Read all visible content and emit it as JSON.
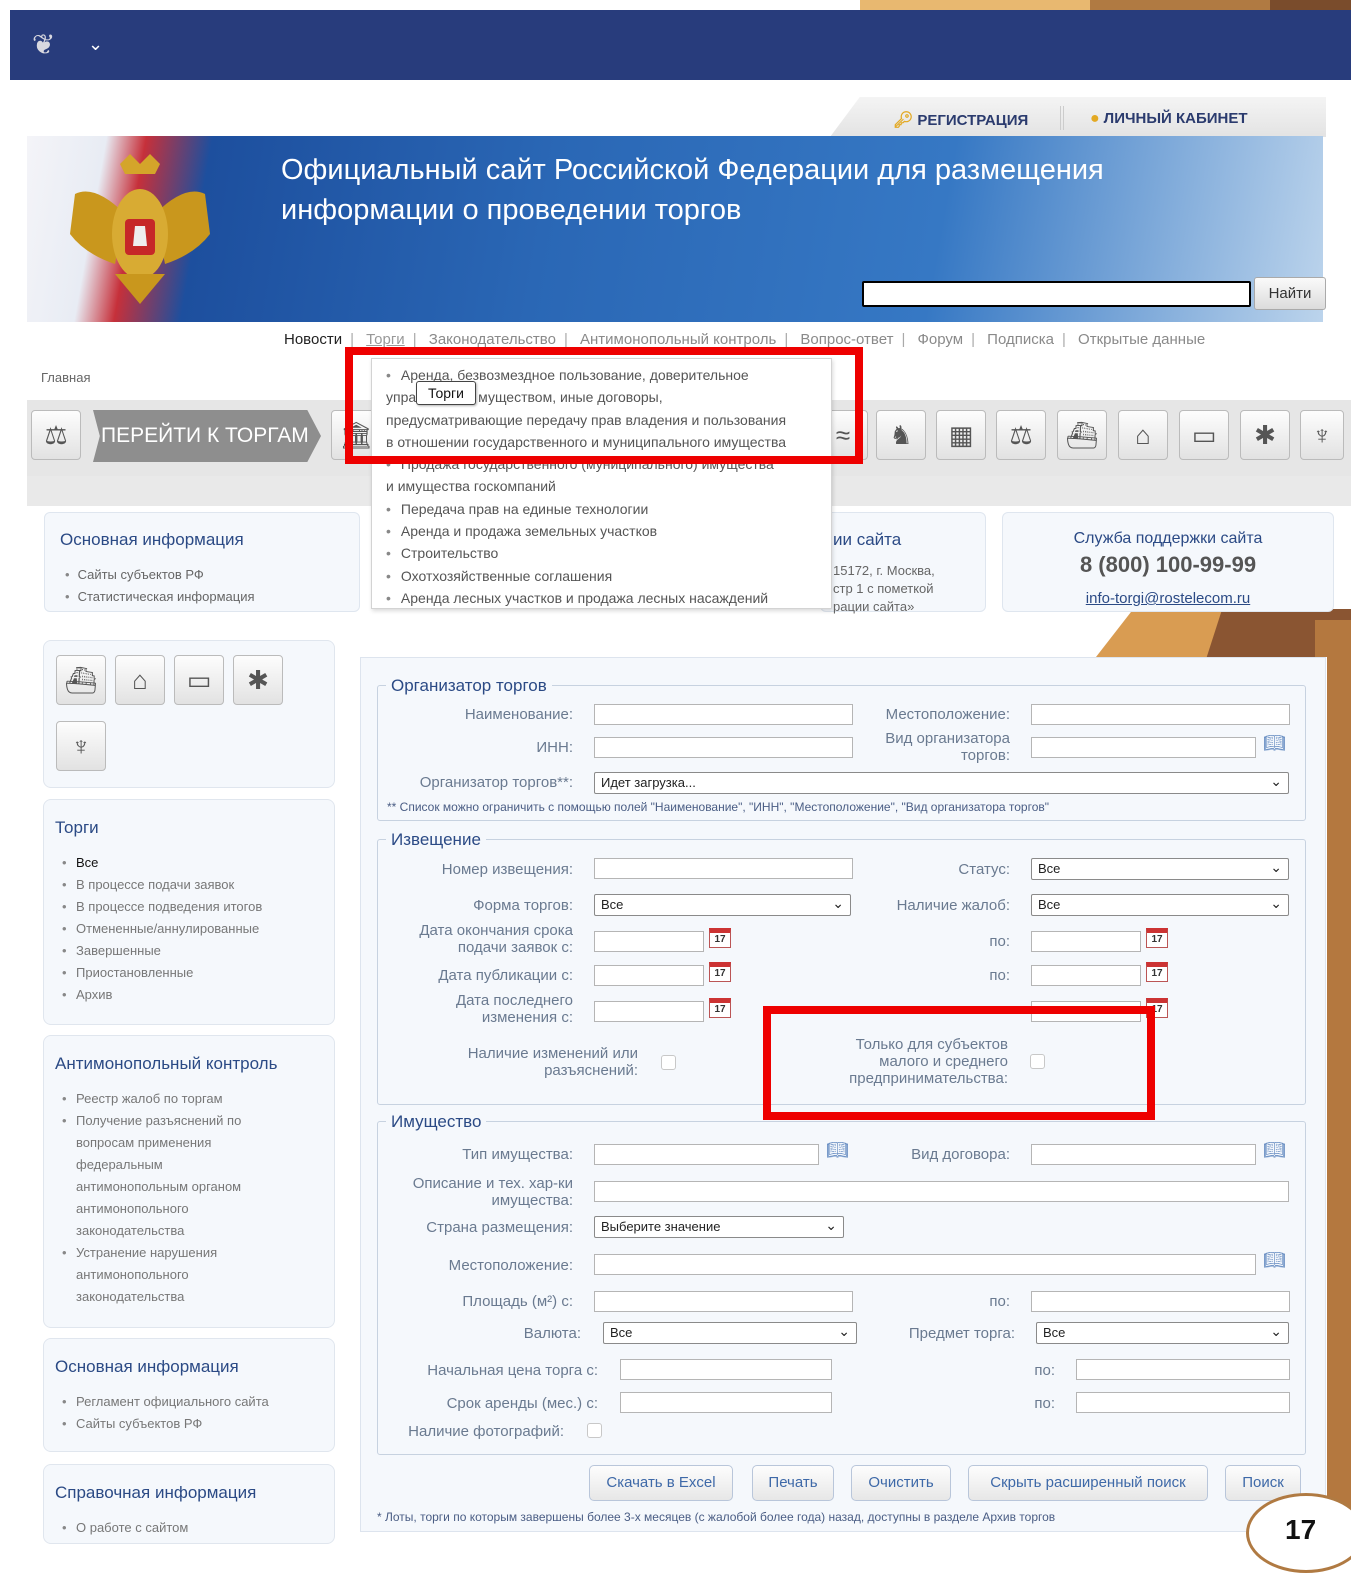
{
  "header": {
    "register": "РЕГИСТРАЦИЯ",
    "cabinet": "ЛИЧНЫЙ КАБИНЕТ",
    "title_line1": "Официальный сайт Российской Федерации для размещения",
    "title_line2": "информации о проведении торгов",
    "search_button": "Найти"
  },
  "nav": [
    "Новости",
    "Торги",
    "Законодательство",
    "Антимонопольный контроль",
    "Вопрос-ответ",
    "Форум",
    "Подписка",
    "Открытые данные"
  ],
  "breadcrumb": "Главная",
  "goto_torgi": "ПЕРЕЙТИ К ТОРГАМ",
  "tooltip": "Торги",
  "dropdown": {
    "line1": "Аренда, безвозмездное пользование, доверительное",
    "line2_a": "упра",
    "line2_b": "муществом, иные договоры,",
    "line3": "предусматривающие передачу прав владения и пользования",
    "line4": "в отношении государственного и муниципального имущества",
    "line5": "Продажа государственного (муниципального) имущества",
    "line6": "и имущества госкомпаний",
    "line7": "Передача прав на единые технологии",
    "line8": "Аренда и продажа земельных участков",
    "line9": "Строительство",
    "line10": "Охотхозяйственные соглашения",
    "line11": "Аренда лесных участков и продажа лесных насаждений"
  },
  "info_top": {
    "main_title": "Основная информация",
    "main_items": [
      "Сайты субъектов РФ",
      "Статистическая информация"
    ],
    "middle_title": "ии сайта",
    "middle_l1": "15172, г. Москва,",
    "middle_l2": "стр 1 с пометкой",
    "middle_l3": "рации сайта»",
    "support_title": "Служба поддержки сайта",
    "support_phone": "8 (800) 100-99-99",
    "support_email": "info-torgi@rostelecom.ru"
  },
  "sidebar": {
    "torgi_title": "Торги",
    "torgi_items": [
      "Все",
      "В процессе подачи заявок",
      "В процессе подведения итогов",
      "Отмененные/аннулированные",
      "Завершенные",
      "Приостановленные",
      "Архив"
    ],
    "anti_title": "Антимонопольный контроль",
    "anti_items": [
      "Реестр жалоб по торгам",
      "Получение разъяснений по вопросам применения федеральным антимонопольным органом антимонопольного законодательства",
      "Устранение нарушения антимонопольного законодательства"
    ],
    "main_title": "Основная информация",
    "main_items": [
      "Регламент официального сайта",
      "Сайты субъектов РФ"
    ],
    "ref_title": "Справочная информация",
    "ref_items": [
      "О работе с сайтом"
    ]
  },
  "form": {
    "org_legend": "Организатор торгов",
    "org_name": "Наименование:",
    "org_location": "Местоположение:",
    "org_inn": "ИНН:",
    "org_type_l1": "Вид организатора",
    "org_type_l2": "торгов:",
    "org_select_label": "Организатор торгов**:",
    "org_select_value": "Идет загрузка...",
    "org_note": "** Список можно ограничить с помощью полей \"Наименование\", \"ИНН\", \"Местоположение\", \"Вид организатора торгов\"",
    "notice_legend": "Извещение",
    "notice_number": "Номер извещения:",
    "status": "Статус:",
    "status_value": "Все",
    "form_torgi": "Форма торгов:",
    "form_torgi_value": "Все",
    "complaints": "Наличие жалоб:",
    "complaints_value": "Все",
    "deadline_l1": "Дата окончания срока",
    "deadline_l2": "подачи заявок с:",
    "pub_date": "Дата публикации с:",
    "last_change_l1": "Дата последнего",
    "last_change_l2": "изменения с:",
    "to": "по:",
    "cal_day": "17",
    "changes_l1": "Наличие изменений или",
    "changes_l2": "разъяснений:",
    "sme_l1": "Только для субъектов",
    "sme_l2": "малого и среднего",
    "sme_l3": "предпринимательства:",
    "property_legend": "Имущество",
    "prop_type": "Тип имущества:",
    "contract_type": "Вид договора:",
    "desc_l1": "Описание и тех. хар-ки",
    "desc_l2": "имущества:",
    "country": "Страна размещения:",
    "country_value": "Выберите значение",
    "location": "Местоположение:",
    "area": "Площадь (м²) с:",
    "currency": "Валюта:",
    "currency_value": "Все",
    "subject": "Предмет торга:",
    "subject_value": "Все",
    "start_price": "Начальная цена торга с:",
    "lease_term": "Срок аренды (мес.) с:",
    "photos": "Наличие фотографий:",
    "footnote": "* Лоты, торги по которым завершены более 3-х месяцев (с жалобой более года) назад, доступны в разделе Архив торгов"
  },
  "buttons": {
    "excel": "Скачать в Excel",
    "print": "Печать",
    "clear": "Очистить",
    "hide": "Скрыть расширенный поиск",
    "search": "Поиск"
  },
  "slide_number": "17",
  "icons": [
    "emblem-icon",
    "chevron-down-icon",
    "key-icon",
    "lock-icon",
    "eagle-icon",
    "auction-hammer-icon",
    "building-icon",
    "bull-icon",
    "bank-icon",
    "scales-icon",
    "ship-icon",
    "house-icon",
    "monitor-icon",
    "power-tower-icon",
    "radio-tower-icon",
    "book-icon",
    "calendar-icon"
  ],
  "colors": {
    "topbar": "#283c7c",
    "accent": "#2b4a85",
    "highlight": "#ee0000",
    "slide_brown": "#b07a42"
  }
}
